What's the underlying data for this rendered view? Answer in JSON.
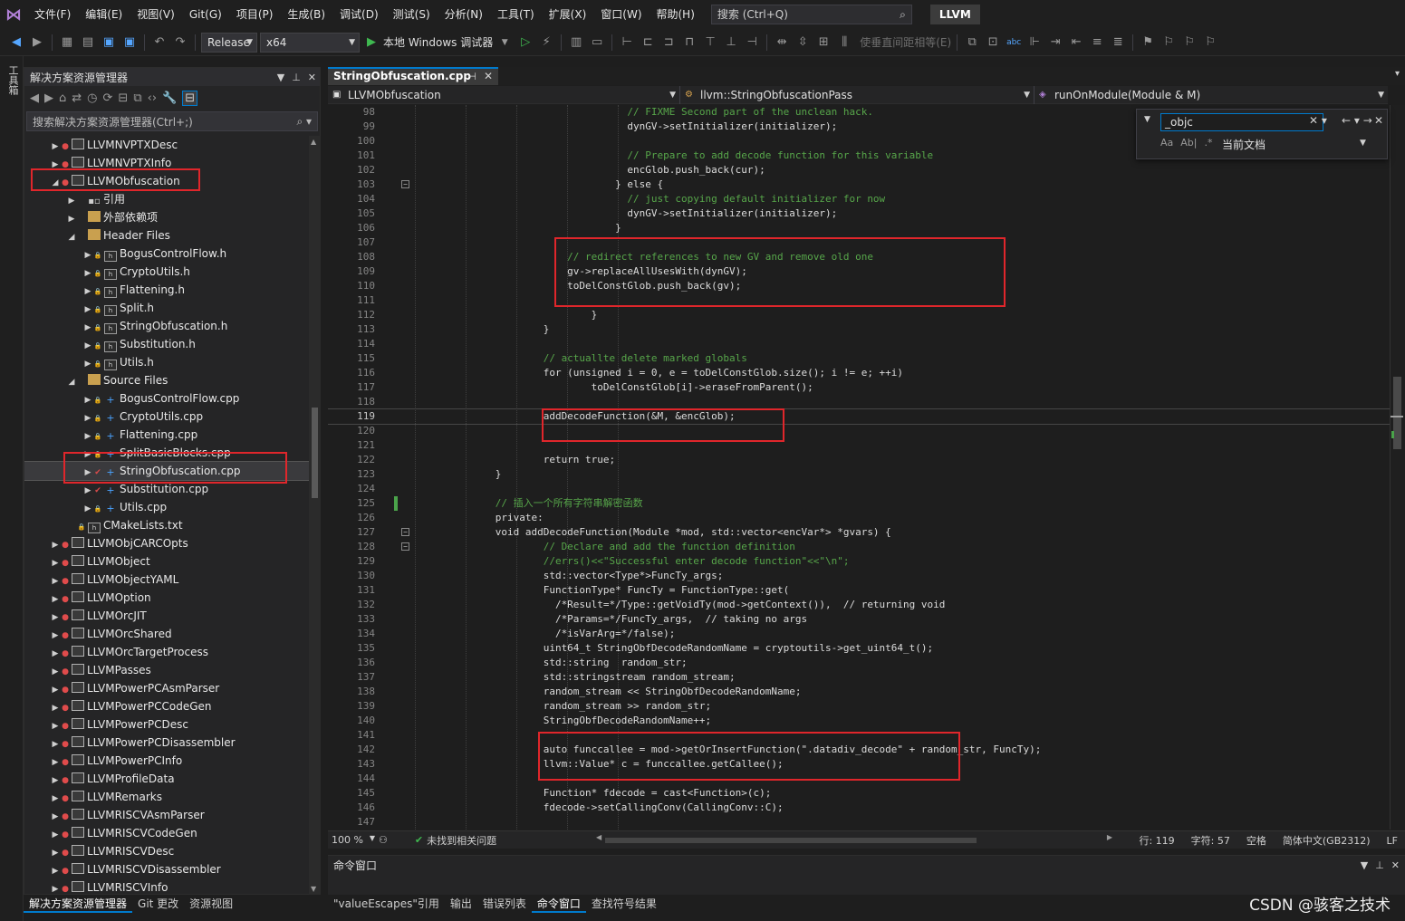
{
  "menubar": {
    "items": [
      "文件(F)",
      "编辑(E)",
      "视图(V)",
      "Git(G)",
      "项目(P)",
      "生成(B)",
      "调试(D)",
      "测试(S)",
      "分析(N)",
      "工具(T)",
      "扩展(X)",
      "窗口(W)",
      "帮助(H)"
    ],
    "search_placeholder": "搜索 (Ctrl+Q)",
    "solution_name": "LLVM"
  },
  "toolbar": {
    "configuration": "Release",
    "platform": "x64",
    "run_label": "本地 Windows 调试器",
    "faded_label": "使垂直间距相等(E)"
  },
  "toolbox_label": "工具箱",
  "explorer": {
    "title": "解决方案资源管理器",
    "search_placeholder": "搜索解决方案资源管理器(Ctrl+;)",
    "rows": [
      {
        "label": "LLVMNVPTXDesc",
        "exp": "▶",
        "mark": "●",
        "markClass": "red",
        "icon": "proj",
        "indent": 0
      },
      {
        "label": "LLVMNVPTXInfo",
        "exp": "▶",
        "mark": "●",
        "markClass": "red",
        "icon": "proj",
        "indent": 0
      },
      {
        "label": "LLVMObfuscation",
        "exp": "◢",
        "mark": "●",
        "markClass": "red",
        "icon": "proj",
        "indent": 0
      },
      {
        "label": "引用",
        "exp": "▶",
        "mark": "",
        "markClass": "",
        "icon": "ref",
        "indent": 1
      },
      {
        "label": "外部依赖项",
        "exp": "▶",
        "mark": "",
        "markClass": "",
        "icon": "folder",
        "indent": 1
      },
      {
        "label": "Header Files",
        "exp": "◢",
        "mark": "",
        "markClass": "",
        "icon": "folder",
        "indent": 1
      },
      {
        "label": "BogusControlFlow.h",
        "exp": "▶",
        "mark": "🔒",
        "markClass": "lock",
        "icon": "hdr",
        "indent": 2
      },
      {
        "label": "CryptoUtils.h",
        "exp": "▶",
        "mark": "🔒",
        "markClass": "lock",
        "icon": "hdr",
        "indent": 2
      },
      {
        "label": "Flattening.h",
        "exp": "▶",
        "mark": "🔒",
        "markClass": "lock",
        "icon": "hdr",
        "indent": 2
      },
      {
        "label": "Split.h",
        "exp": "▶",
        "mark": "🔒",
        "markClass": "lock",
        "icon": "hdr",
        "indent": 2
      },
      {
        "label": "StringObfuscation.h",
        "exp": "▶",
        "mark": "🔒",
        "markClass": "lock",
        "icon": "hdr",
        "indent": 2
      },
      {
        "label": "Substitution.h",
        "exp": "▶",
        "mark": "🔒",
        "markClass": "lock",
        "icon": "hdr",
        "indent": 2
      },
      {
        "label": "Utils.h",
        "exp": "▶",
        "mark": "🔒",
        "markClass": "lock",
        "icon": "hdr",
        "indent": 2
      },
      {
        "label": "Source Files",
        "exp": "◢",
        "mark": "",
        "markClass": "",
        "icon": "folder",
        "indent": 1
      },
      {
        "label": "BogusControlFlow.cpp",
        "exp": "▶",
        "mark": "🔒",
        "markClass": "lock",
        "icon": "cpp",
        "indent": 2
      },
      {
        "label": "CryptoUtils.cpp",
        "exp": "▶",
        "mark": "🔒",
        "markClass": "lock",
        "icon": "cpp",
        "indent": 2
      },
      {
        "label": "Flattening.cpp",
        "exp": "▶",
        "mark": "🔒",
        "markClass": "lock",
        "icon": "cpp",
        "indent": 2
      },
      {
        "label": "SplitBasicBlocks.cpp",
        "exp": "▶",
        "mark": "🔒",
        "markClass": "lock",
        "icon": "cpp",
        "indent": 2
      },
      {
        "label": "StringObfuscation.cpp",
        "exp": "▶",
        "mark": "✔",
        "markClass": "check",
        "icon": "cpp",
        "indent": 2,
        "selected": true
      },
      {
        "label": "Substitution.cpp",
        "exp": "▶",
        "mark": "✔",
        "markClass": "check",
        "icon": "cpp",
        "indent": 2
      },
      {
        "label": "Utils.cpp",
        "exp": "▶",
        "mark": "🔒",
        "markClass": "lock",
        "icon": "cpp",
        "indent": 2
      },
      {
        "label": "CMakeLists.txt",
        "exp": "",
        "mark": "🔒",
        "markClass": "lock",
        "icon": "hdr",
        "indent": 1
      },
      {
        "label": "LLVMObjCARCOpts",
        "exp": "▶",
        "mark": "●",
        "markClass": "red",
        "icon": "proj",
        "indent": 0
      },
      {
        "label": "LLVMObject",
        "exp": "▶",
        "mark": "●",
        "markClass": "red",
        "icon": "proj",
        "indent": 0
      },
      {
        "label": "LLVMObjectYAML",
        "exp": "▶",
        "mark": "●",
        "markClass": "red",
        "icon": "proj",
        "indent": 0
      },
      {
        "label": "LLVMOption",
        "exp": "▶",
        "mark": "●",
        "markClass": "red",
        "icon": "proj",
        "indent": 0
      },
      {
        "label": "LLVMOrcJIT",
        "exp": "▶",
        "mark": "●",
        "markClass": "red",
        "icon": "proj",
        "indent": 0
      },
      {
        "label": "LLVMOrcShared",
        "exp": "▶",
        "mark": "●",
        "markClass": "red",
        "icon": "proj",
        "indent": 0
      },
      {
        "label": "LLVMOrcTargetProcess",
        "exp": "▶",
        "mark": "●",
        "markClass": "red",
        "icon": "proj",
        "indent": 0
      },
      {
        "label": "LLVMPasses",
        "exp": "▶",
        "mark": "●",
        "markClass": "red",
        "icon": "proj",
        "indent": 0
      },
      {
        "label": "LLVMPowerPCAsmParser",
        "exp": "▶",
        "mark": "●",
        "markClass": "red",
        "icon": "proj",
        "indent": 0
      },
      {
        "label": "LLVMPowerPCCodeGen",
        "exp": "▶",
        "mark": "●",
        "markClass": "red",
        "icon": "proj",
        "indent": 0
      },
      {
        "label": "LLVMPowerPCDesc",
        "exp": "▶",
        "mark": "●",
        "markClass": "red",
        "icon": "proj",
        "indent": 0
      },
      {
        "label": "LLVMPowerPCDisassembler",
        "exp": "▶",
        "mark": "●",
        "markClass": "red",
        "icon": "proj",
        "indent": 0
      },
      {
        "label": "LLVMPowerPCInfo",
        "exp": "▶",
        "mark": "●",
        "markClass": "red",
        "icon": "proj",
        "indent": 0
      },
      {
        "label": "LLVMProfileData",
        "exp": "▶",
        "mark": "●",
        "markClass": "red",
        "icon": "proj",
        "indent": 0
      },
      {
        "label": "LLVMRemarks",
        "exp": "▶",
        "mark": "●",
        "markClass": "red",
        "icon": "proj",
        "indent": 0
      },
      {
        "label": "LLVMRISCVAsmParser",
        "exp": "▶",
        "mark": "●",
        "markClass": "red",
        "icon": "proj",
        "indent": 0
      },
      {
        "label": "LLVMRISCVCodeGen",
        "exp": "▶",
        "mark": "●",
        "markClass": "red",
        "icon": "proj",
        "indent": 0
      },
      {
        "label": "LLVMRISCVDesc",
        "exp": "▶",
        "mark": "●",
        "markClass": "red",
        "icon": "proj",
        "indent": 0
      },
      {
        "label": "LLVMRISCVDisassembler",
        "exp": "▶",
        "mark": "●",
        "markClass": "red",
        "icon": "proj",
        "indent": 0
      },
      {
        "label": "LLVMRISCVInfo",
        "exp": "▶",
        "mark": "●",
        "markClass": "red",
        "icon": "proj",
        "indent": 0
      }
    ],
    "bottom_tabs": [
      "解决方案资源管理器",
      "Git 更改",
      "资源视图"
    ]
  },
  "editor": {
    "tab_title": "StringObfuscation.cpp",
    "nav_project": "LLVMObfuscation",
    "nav_class": "llvm::StringObfuscationPass",
    "nav_member": "runOnModule(Module & M)",
    "find_text": "_objc",
    "find_scope": "当前文档",
    "current_line": 119,
    "lines": [
      {
        "n": 98,
        "text": "                                    // FIXME Second part of the unclean hack."
      },
      {
        "n": 99,
        "text": "                                    dynGV->setInitializer(initializer);"
      },
      {
        "n": 100,
        "text": ""
      },
      {
        "n": 101,
        "text": "                                    // Prepare to add decode function for this variable"
      },
      {
        "n": 102,
        "text": "                                    encGlob.push_back(cur);"
      },
      {
        "n": 103,
        "text": "                                  } else {",
        "fold": true
      },
      {
        "n": 104,
        "text": "                                    // just copying default initializer for now"
      },
      {
        "n": 105,
        "text": "                                    dynGV->setInitializer(initializer);"
      },
      {
        "n": 106,
        "text": "                                  }"
      },
      {
        "n": 107,
        "text": ""
      },
      {
        "n": 108,
        "text": "                          // redirect references to new GV and remove old one"
      },
      {
        "n": 109,
        "text": "                          gv->replaceAllUsesWith(dynGV);"
      },
      {
        "n": 110,
        "text": "                          toDelConstGlob.push_back(gv);"
      },
      {
        "n": 111,
        "text": ""
      },
      {
        "n": 112,
        "text": "                              }"
      },
      {
        "n": 113,
        "text": "                      }"
      },
      {
        "n": 114,
        "text": ""
      },
      {
        "n": 115,
        "text": "                      // actuallte delete marked globals"
      },
      {
        "n": 116,
        "text": "                      for (unsigned i = 0, e = toDelConstGlob.size(); i != e; ++i)"
      },
      {
        "n": 117,
        "text": "                              toDelConstGlob[i]->eraseFromParent();"
      },
      {
        "n": 118,
        "text": ""
      },
      {
        "n": 119,
        "text": "                      addDecodeFunction(&M, &encGlob);"
      },
      {
        "n": 120,
        "text": ""
      },
      {
        "n": 121,
        "text": ""
      },
      {
        "n": 122,
        "text": "                      return true;"
      },
      {
        "n": 123,
        "text": "              }"
      },
      {
        "n": 124,
        "text": ""
      },
      {
        "n": 125,
        "text": "              // 插入一个所有字符串解密函数",
        "changed": true
      },
      {
        "n": 126,
        "text": "              private:"
      },
      {
        "n": 127,
        "text": "              void addDecodeFunction(Module *mod, std::vector<encVar*> *gvars) {",
        "fold": true
      },
      {
        "n": 128,
        "text": "                      // Declare and add the function definition",
        "fold": true
      },
      {
        "n": 129,
        "text": "                      //errs()<<\"Successful enter decode function\"<<\"\\n\";"
      },
      {
        "n": 130,
        "text": "                      std::vector<Type*>FuncTy_args;"
      },
      {
        "n": 131,
        "text": "                      FunctionType* FuncTy = FunctionType::get("
      },
      {
        "n": 132,
        "text": "                        /*Result=*/Type::getVoidTy(mod->getContext()),  // returning void"
      },
      {
        "n": 133,
        "text": "                        /*Params=*/FuncTy_args,  // taking no args"
      },
      {
        "n": 134,
        "text": "                        /*isVarArg=*/false);"
      },
      {
        "n": 135,
        "text": "                      uint64_t StringObfDecodeRandomName = cryptoutils->get_uint64_t();"
      },
      {
        "n": 136,
        "text": "                      std::string  random_str;"
      },
      {
        "n": 137,
        "text": "                      std::stringstream random_stream;"
      },
      {
        "n": 138,
        "text": "                      random_stream << StringObfDecodeRandomName;"
      },
      {
        "n": 139,
        "text": "                      random_stream >> random_str;"
      },
      {
        "n": 140,
        "text": "                      StringObfDecodeRandomName++;"
      },
      {
        "n": 141,
        "text": ""
      },
      {
        "n": 142,
        "text": "                      auto funccallee = mod->getOrInsertFunction(\".datadiv_decode\" + random_str, FuncTy);"
      },
      {
        "n": 143,
        "text": "                      llvm::Value* c = funccallee.getCallee();"
      },
      {
        "n": 144,
        "text": ""
      },
      {
        "n": 145,
        "text": "                      Function* fdecode = cast<Function>(c);"
      },
      {
        "n": 146,
        "text": "                      fdecode->setCallingConv(CallingConv::C);"
      },
      {
        "n": 147,
        "text": ""
      }
    ]
  },
  "status": {
    "zoom": "100 %",
    "issues": "未找到相关问题",
    "line": "行: 119",
    "char": "字符: 57",
    "spacing": "空格",
    "encoding": "简体中文(GB2312)",
    "eol": "LF"
  },
  "command_window": {
    "title": "命令窗口",
    "tabs": [
      "\"valueEscapes\"引用",
      "输出",
      "错误列表",
      "命令窗口",
      "查找符号结果"
    ]
  },
  "watermark": "CSDN @骇客之技术",
  "colors": {
    "accent": "#007acc",
    "highlight_box": "#e0262b",
    "comment": "#57a64a",
    "keyword": "#569cd6",
    "type": "#4ec9b0",
    "function": "#dcdcaa",
    "string": "#d69d85",
    "variable": "#9cdcfe"
  }
}
